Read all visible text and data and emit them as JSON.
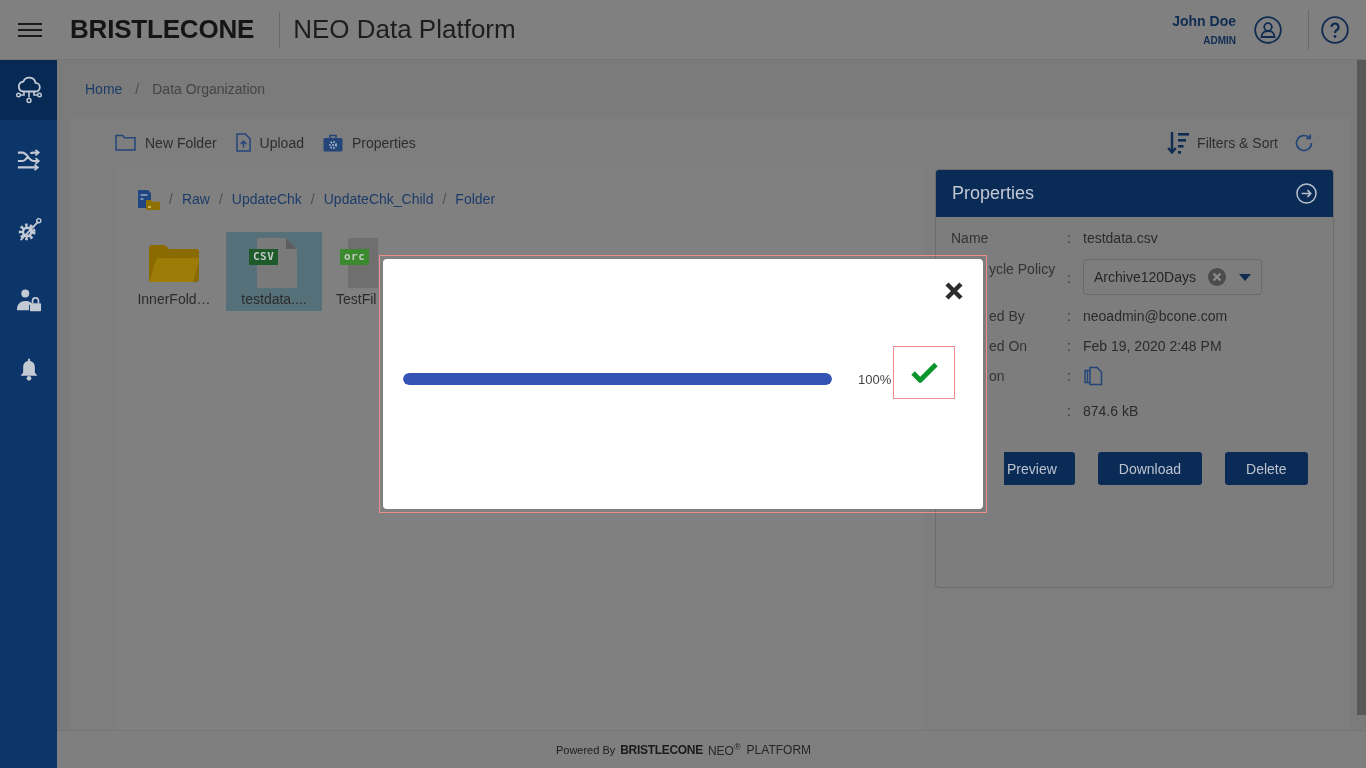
{
  "header": {
    "brand": "BRISTLECONE",
    "product": "NEO Data Platform",
    "user": {
      "name": "John Doe",
      "role": "ADMIN"
    }
  },
  "sidebar": {
    "items": [
      {
        "selected": true
      },
      {
        "selected": false
      },
      {
        "selected": false
      },
      {
        "selected": false
      },
      {
        "selected": false
      }
    ]
  },
  "breadcrumb": [
    {
      "label": "Home",
      "current": false
    },
    {
      "separator": "/",
      "label": "Data Organization",
      "current": true
    }
  ],
  "toolbar": {
    "actions": [
      {
        "label": "New Folder"
      },
      {
        "label": "Upload"
      },
      {
        "label": "Properties"
      }
    ],
    "filters": "Filters & Sort"
  },
  "path": [
    {
      "separator": "/",
      "label": "Raw"
    },
    {
      "separator": "/",
      "label": "UpdateChk"
    },
    {
      "separator": "/",
      "label": "UpdateChk_Child"
    },
    {
      "separator": "/",
      "label": "Folder"
    }
  ],
  "files": [
    {
      "kind": "folder",
      "label": "InnerFold…",
      "selected": false,
      "partially_hidden": false
    },
    {
      "kind": "document",
      "badge": "CSV",
      "color": "#1e5b2b",
      "label": "testdata....",
      "selected": true,
      "partially_hidden": false
    },
    {
      "kind": "document",
      "badge": "orc",
      "color": "#3c8a2e",
      "label": "TestFil",
      "selected": false,
      "partially_hidden": true
    }
  ],
  "properties_panel": {
    "title": "Properties",
    "rows": [
      {
        "kind": "text",
        "label": "Name",
        "separator": ":",
        "value": "testdata.csv"
      },
      {
        "kind": "dropdown",
        "label": "ycle Policy",
        "separator": ":",
        "value": "Archive120Days",
        "partially_hidden": true
      },
      {
        "kind": "text",
        "label": "ed By",
        "separator": ":",
        "value": "neoadmin@bcone.com",
        "partially_hidden": true
      },
      {
        "kind": "text",
        "label": "ed On",
        "separator": ":",
        "value": "Feb 19, 2020 2:48 PM",
        "partially_hidden": true
      },
      {
        "kind": "icon",
        "label": "on",
        "separator": ":",
        "partially_hidden": true
      },
      {
        "kind": "text",
        "separator": ":",
        "value": "874.6 kB"
      }
    ],
    "buttons": [
      {
        "label": "Preview",
        "partially_hidden": true
      },
      {
        "label": "Download",
        "partially_hidden": false
      },
      {
        "label": "Delete",
        "partially_hidden": false
      }
    ]
  },
  "upload_dialog": {
    "progress": {
      "level": 1,
      "reading": "100%"
    },
    "complete": true
  },
  "footer": {
    "powered_by": "Powered By",
    "brand": "BRISTLECONE",
    "product": "NEO$^{®}$",
    "platform": "PLATFORM"
  }
}
